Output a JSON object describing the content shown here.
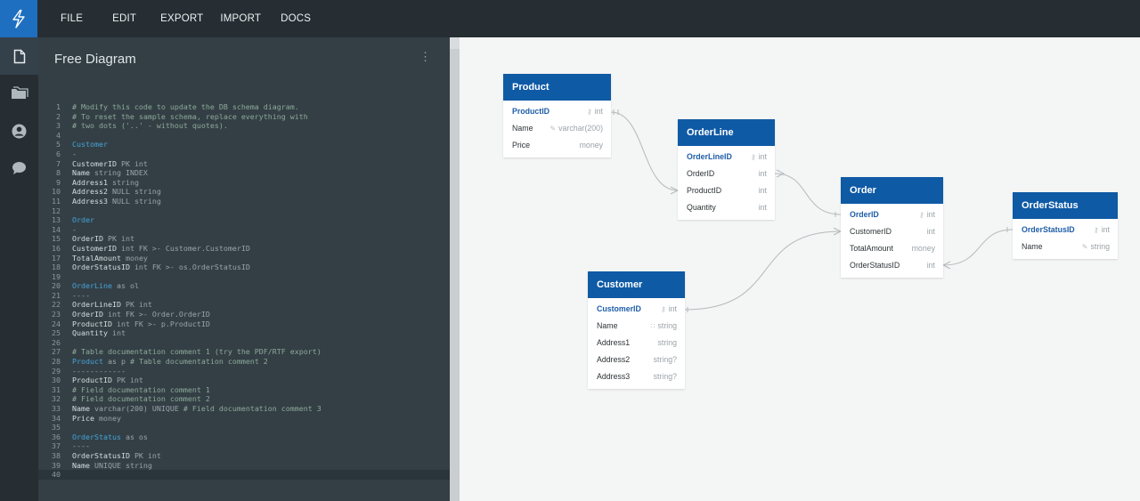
{
  "menu": [
    "FILE",
    "EDIT",
    "EXPORT",
    "IMPORT",
    "DOCS"
  ],
  "editor": {
    "title": "Free Diagram",
    "menu_icon": "⋮"
  },
  "code_lines": [
    {
      "n": "1",
      "parts": [
        [
          "# Modify this code to update the DB schema diagram.",
          "cmt2"
        ]
      ]
    },
    {
      "n": "2",
      "parts": [
        [
          "# To reset the sample schema, replace everything with",
          "cmt2"
        ]
      ]
    },
    {
      "n": "3",
      "parts": [
        [
          "# two dots ('..' - without quotes).",
          "cmt2"
        ]
      ]
    },
    {
      "n": "4",
      "parts": []
    },
    {
      "n": "5",
      "parts": [
        [
          "Customer",
          "tblc"
        ]
      ]
    },
    {
      "n": "6",
      "parts": [
        [
          "-",
          "typ"
        ]
      ]
    },
    {
      "n": "7",
      "parts": [
        [
          "CustomerID ",
          ""
        ],
        [
          "PK int",
          "typ"
        ]
      ]
    },
    {
      "n": "8",
      "parts": [
        [
          "Name ",
          ""
        ],
        [
          "string INDEX",
          "typ"
        ]
      ]
    },
    {
      "n": "9",
      "parts": [
        [
          "Address1 ",
          ""
        ],
        [
          "string",
          "typ"
        ]
      ]
    },
    {
      "n": "10",
      "parts": [
        [
          "Address2 ",
          ""
        ],
        [
          "NULL string",
          "typ"
        ]
      ]
    },
    {
      "n": "11",
      "parts": [
        [
          "Address3 ",
          ""
        ],
        [
          "NULL string",
          "typ"
        ]
      ]
    },
    {
      "n": "12",
      "parts": []
    },
    {
      "n": "13",
      "parts": [
        [
          "Order",
          "tblc"
        ]
      ]
    },
    {
      "n": "14",
      "parts": [
        [
          "-",
          "typ"
        ]
      ]
    },
    {
      "n": "15",
      "parts": [
        [
          "OrderID ",
          ""
        ],
        [
          "PK int",
          "typ"
        ]
      ]
    },
    {
      "n": "16",
      "parts": [
        [
          "CustomerID ",
          ""
        ],
        [
          "int FK >- Customer.CustomerID",
          "typ"
        ]
      ]
    },
    {
      "n": "17",
      "parts": [
        [
          "TotalAmount ",
          ""
        ],
        [
          "money",
          "typ"
        ]
      ]
    },
    {
      "n": "18",
      "parts": [
        [
          "OrderStatusID ",
          ""
        ],
        [
          "int FK >- os.OrderStatusID",
          "typ"
        ]
      ]
    },
    {
      "n": "19",
      "parts": []
    },
    {
      "n": "20",
      "parts": [
        [
          "OrderLine",
          "tblc"
        ],
        [
          " as ol",
          "typ"
        ]
      ]
    },
    {
      "n": "21",
      "parts": [
        [
          "----",
          "typ"
        ]
      ]
    },
    {
      "n": "22",
      "parts": [
        [
          "OrderLineID ",
          ""
        ],
        [
          "PK int",
          "typ"
        ]
      ]
    },
    {
      "n": "23",
      "parts": [
        [
          "OrderID ",
          ""
        ],
        [
          "int FK >- Order.OrderID",
          "typ"
        ]
      ]
    },
    {
      "n": "24",
      "parts": [
        [
          "ProductID ",
          ""
        ],
        [
          "int FK >- p.ProductID",
          "typ"
        ]
      ]
    },
    {
      "n": "25",
      "parts": [
        [
          "Quantity ",
          ""
        ],
        [
          "int",
          "typ"
        ]
      ]
    },
    {
      "n": "26",
      "parts": []
    },
    {
      "n": "27",
      "parts": [
        [
          "# Table documentation comment 1 (try the PDF/RTF export)",
          "cmt2"
        ]
      ]
    },
    {
      "n": "28",
      "parts": [
        [
          "Product",
          "tblc"
        ],
        [
          " as p ",
          "typ"
        ],
        [
          "# Table documentation comment 2",
          "cmt2"
        ]
      ]
    },
    {
      "n": "29",
      "parts": [
        [
          "------------",
          "typ"
        ]
      ]
    },
    {
      "n": "30",
      "parts": [
        [
          "ProductID ",
          ""
        ],
        [
          "PK int",
          "typ"
        ]
      ]
    },
    {
      "n": "31",
      "parts": [
        [
          "# Field documentation comment 1",
          "cmt2"
        ]
      ]
    },
    {
      "n": "32",
      "parts": [
        [
          "# Field documentation comment 2",
          "cmt2"
        ]
      ]
    },
    {
      "n": "33",
      "parts": [
        [
          "Name ",
          ""
        ],
        [
          "varchar(200) UNIQUE ",
          "typ"
        ],
        [
          "# Field documentation comment 3",
          "cmt2"
        ]
      ]
    },
    {
      "n": "34",
      "parts": [
        [
          "Price ",
          ""
        ],
        [
          "money",
          "typ"
        ]
      ]
    },
    {
      "n": "35",
      "parts": []
    },
    {
      "n": "36",
      "parts": [
        [
          "OrderStatus",
          "tblc"
        ],
        [
          " as os",
          "typ"
        ]
      ]
    },
    {
      "n": "37",
      "parts": [
        [
          "----",
          "typ"
        ]
      ]
    },
    {
      "n": "38",
      "parts": [
        [
          "OrderStatusID ",
          ""
        ],
        [
          "PK int",
          "typ"
        ]
      ]
    },
    {
      "n": "39",
      "parts": [
        [
          "Name ",
          ""
        ],
        [
          "UNIQUE string",
          "typ"
        ]
      ]
    },
    {
      "n": "40",
      "parts": []
    }
  ],
  "entities": {
    "product": {
      "title": "Product",
      "fields": [
        {
          "name": "ProductID",
          "type": "int",
          "icon": "key-icon",
          "pk": true
        },
        {
          "name": "Name",
          "type": "varchar(200)",
          "icon": "unique-icon",
          "pk": false
        },
        {
          "name": "Price",
          "type": "money",
          "icon": "",
          "pk": false
        }
      ]
    },
    "orderline": {
      "title": "OrderLine",
      "fields": [
        {
          "name": "OrderLineID",
          "type": "int",
          "icon": "key-icon",
          "pk": true
        },
        {
          "name": "OrderID",
          "type": "int",
          "icon": "",
          "pk": false
        },
        {
          "name": "ProductID",
          "type": "int",
          "icon": "",
          "pk": false
        },
        {
          "name": "Quantity",
          "type": "int",
          "icon": "",
          "pk": false
        }
      ]
    },
    "order": {
      "title": "Order",
      "fields": [
        {
          "name": "OrderID",
          "type": "int",
          "icon": "key-icon",
          "pk": true
        },
        {
          "name": "CustomerID",
          "type": "int",
          "icon": "",
          "pk": false
        },
        {
          "name": "TotalAmount",
          "type": "money",
          "icon": "",
          "pk": false
        },
        {
          "name": "OrderStatusID",
          "type": "int",
          "icon": "",
          "pk": false
        }
      ]
    },
    "orderstatus": {
      "title": "OrderStatus",
      "fields": [
        {
          "name": "OrderStatusID",
          "type": "int",
          "icon": "key-icon",
          "pk": true
        },
        {
          "name": "Name",
          "type": "string",
          "icon": "unique-icon",
          "pk": false
        }
      ]
    },
    "customer": {
      "title": "Customer",
      "fields": [
        {
          "name": "CustomerID",
          "type": "int",
          "icon": "key-icon",
          "pk": true
        },
        {
          "name": "Name",
          "type": "string",
          "icon": "index-icon",
          "pk": false
        },
        {
          "name": "Address1",
          "type": "string",
          "icon": "",
          "pk": false
        },
        {
          "name": "Address2",
          "type": "string?",
          "icon": "",
          "pk": false
        },
        {
          "name": "Address3",
          "type": "string?",
          "icon": "",
          "pk": false
        }
      ]
    }
  },
  "sidebar_icons": [
    "document-icon",
    "folder-icon",
    "account-icon",
    "chat-icon"
  ],
  "colors": {
    "accent": "#1e6fc0",
    "entity_header": "#0f5aa5",
    "pk_text": "#1e5da8",
    "table_name_code": "#46a3d7"
  }
}
